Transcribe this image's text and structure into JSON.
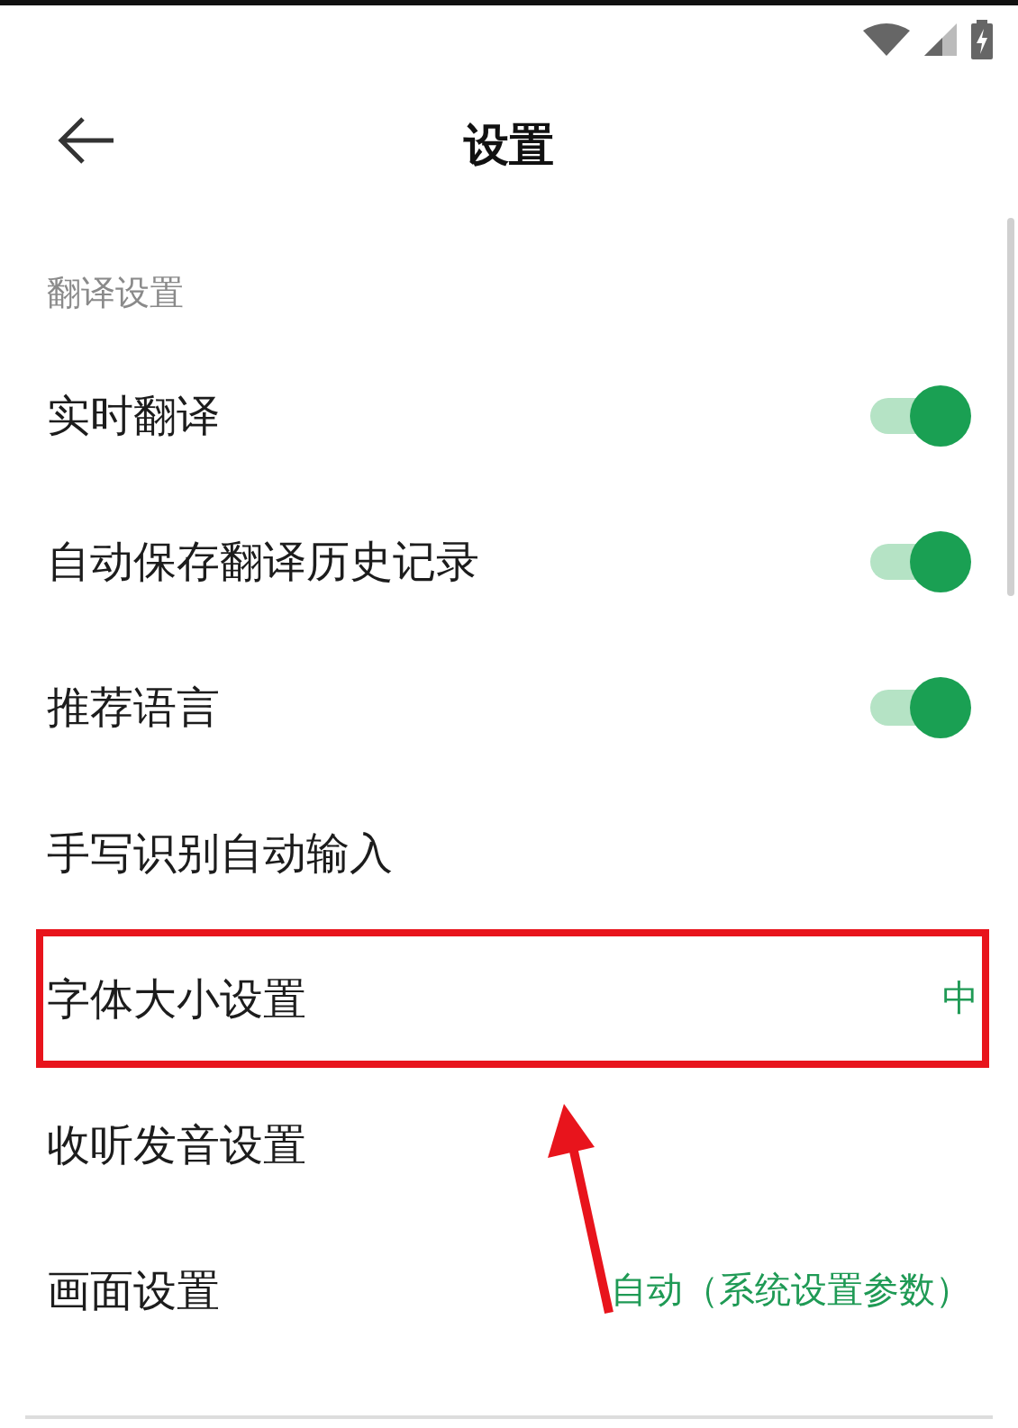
{
  "header": {
    "title": "设置"
  },
  "section": {
    "title": "翻译设置"
  },
  "rows": [
    {
      "label": "实时翻译",
      "kind": "toggle",
      "on": true,
      "highlighted": false
    },
    {
      "label": "自动保存翻译历史记录",
      "kind": "toggle",
      "on": true,
      "highlighted": false
    },
    {
      "label": "推荐语言",
      "kind": "toggle",
      "on": true,
      "highlighted": false
    },
    {
      "label": "手写识别自动输入",
      "kind": "plain",
      "highlighted": false
    },
    {
      "label": "字体大小设置",
      "kind": "value",
      "value": "中",
      "highlighted": true
    },
    {
      "label": "收听发音设置",
      "kind": "plain",
      "highlighted": false
    },
    {
      "label": "画面设置",
      "kind": "value",
      "value": "自动（系统设置参数）",
      "highlighted": false
    }
  ]
}
